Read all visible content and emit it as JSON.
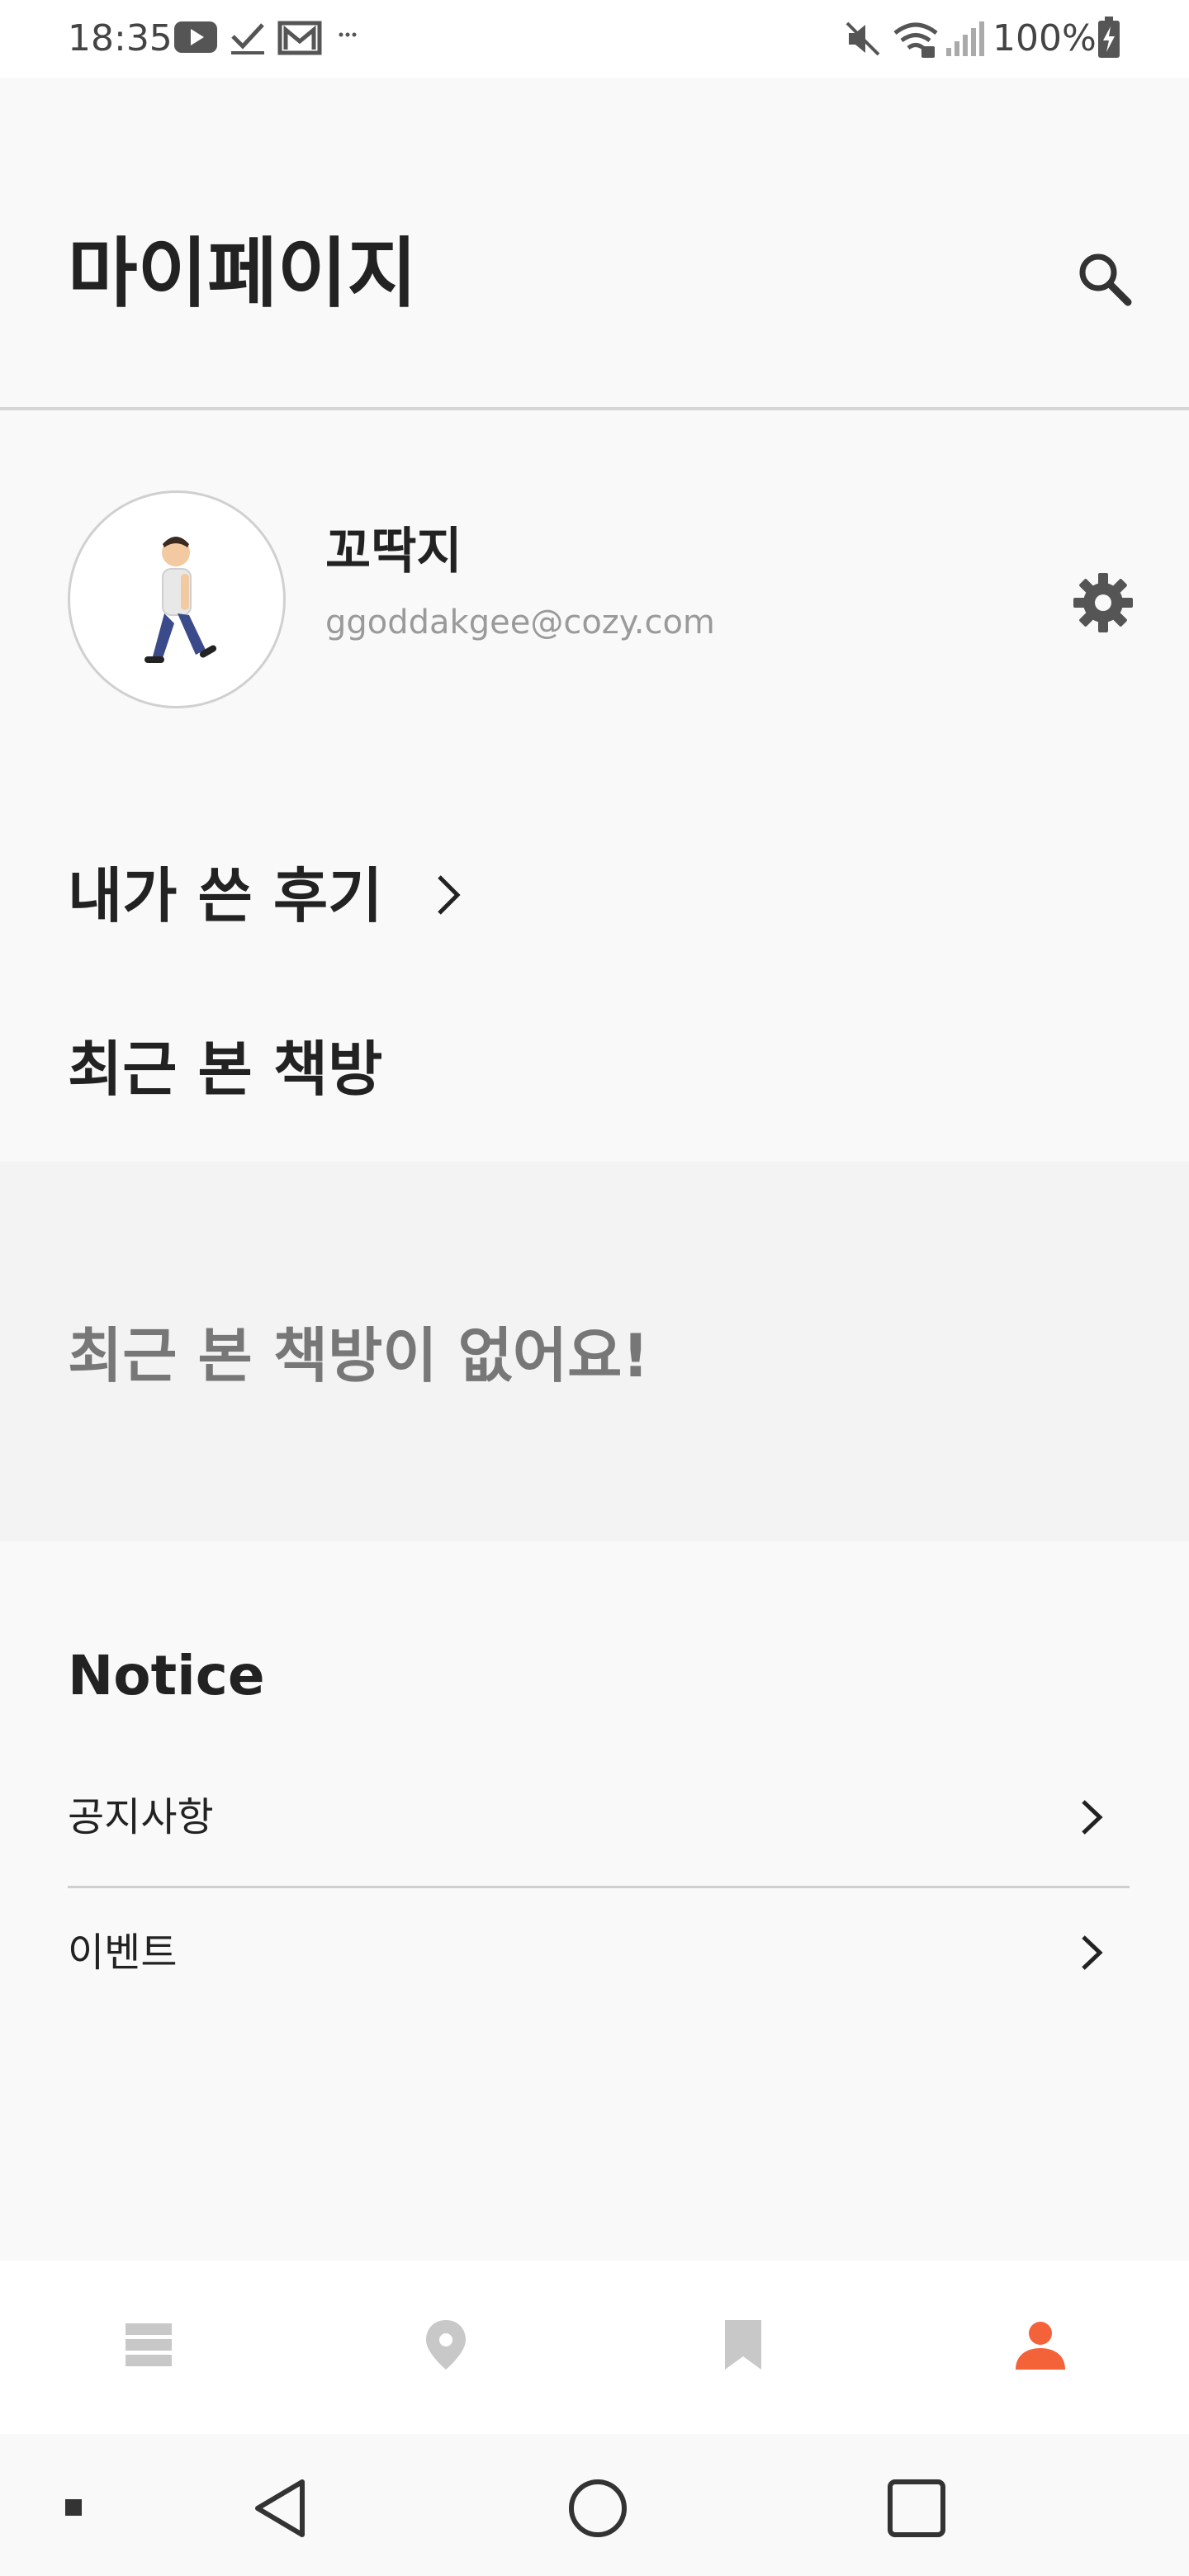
{
  "status_bar": {
    "time": "18:35",
    "battery": "100%",
    "left_icons": [
      "youtube-icon",
      "check-icon",
      "gmail-icon",
      "more-dots-icon"
    ],
    "right_icons": [
      "mute-icon",
      "wifi-icon",
      "signal-icon",
      "battery-charging-icon"
    ]
  },
  "header": {
    "title": "마이페이지",
    "search_icon": "search-icon"
  },
  "profile": {
    "name": "꼬딱지",
    "email": "ggoddakgee@cozy.com",
    "avatar_emoji": "🚶",
    "settings_icon": "gear-icon"
  },
  "reviews": {
    "label": "내가 쓴 후기"
  },
  "recent_rooms": {
    "title": "최근 본 책방",
    "empty_message": "최근 본 책방이 없어요!"
  },
  "notice": {
    "title": "Notice",
    "items": [
      {
        "label": "공지사항"
      },
      {
        "label": "이벤트"
      }
    ]
  },
  "bottom_nav": {
    "items": [
      "list-icon",
      "location-pin-icon",
      "bookmark-icon",
      "person-icon"
    ],
    "active_index": 3,
    "active_color": "#f4623a",
    "inactive_color": "#c8c8c8"
  },
  "system_nav": {
    "buttons": [
      "back-icon",
      "home-icon",
      "recents-icon"
    ]
  }
}
